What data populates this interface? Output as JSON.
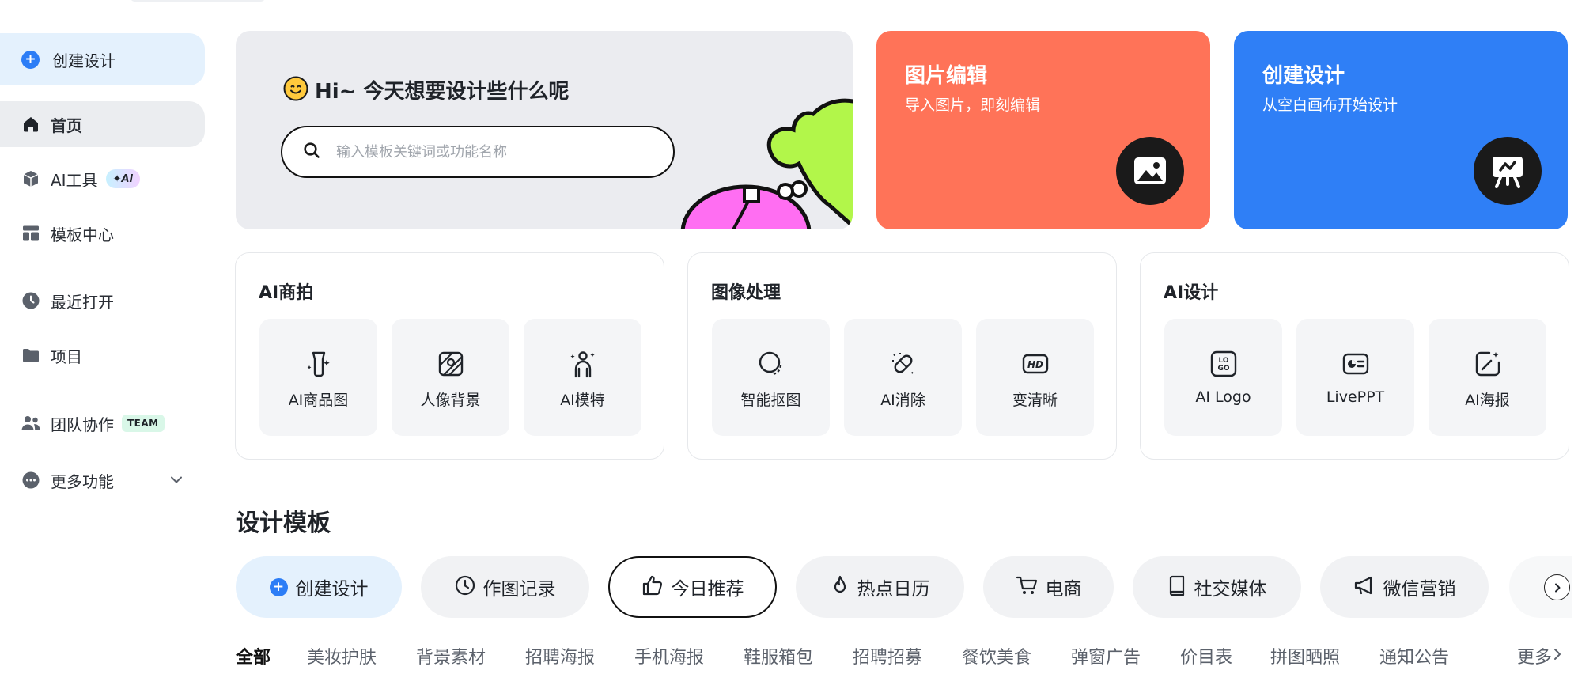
{
  "sidebar": {
    "create_label": "创建设计",
    "home_label": "首页",
    "ai_tools_label": "AI工具",
    "ai_badge": "✦AI",
    "template_center_label": "模板中心",
    "recent_label": "最近打开",
    "projects_label": "项目",
    "team_label": "团队协作",
    "team_badge": "TEAM",
    "more_label": "更多功能"
  },
  "hero": {
    "greeting": "Hi~ 今天想要设计些什么呢",
    "search_placeholder": "输入模板关键词或功能名称"
  },
  "quick_cards": {
    "edit": {
      "title": "图片编辑",
      "subtitle": "导入图片，即刻编辑"
    },
    "create": {
      "title": "创建设计",
      "subtitle": "从空白画布开始设计"
    }
  },
  "tool_groups": {
    "ai_shoot": {
      "title": "AI商拍",
      "items": [
        "AI商品图",
        "人像背景",
        "AI模特"
      ]
    },
    "image_proc": {
      "title": "图像处理",
      "items": [
        "智能抠图",
        "AI消除",
        "变清晰"
      ]
    },
    "ai_design": {
      "title": "AI设计",
      "items": [
        "AI Logo",
        "LivePPT",
        "AI海报"
      ]
    }
  },
  "templates": {
    "title": "设计模板",
    "chips": [
      "创建设计",
      "作图记录",
      "今日推荐",
      "热点日历",
      "电商",
      "社交媒体",
      "微信营销"
    ],
    "categories": [
      "全部",
      "美妆护肤",
      "背景素材",
      "招聘海报",
      "手机海报",
      "鞋服箱包",
      "招聘招募",
      "餐饮美食",
      "弹窗广告",
      "价目表",
      "拼图晒照",
      "通知公告"
    ],
    "more_label": "更多"
  },
  "colors": {
    "accent_blue": "#2f7ff6",
    "edit_orange": "#ff7358",
    "active_bg": "#e4f1fd"
  }
}
